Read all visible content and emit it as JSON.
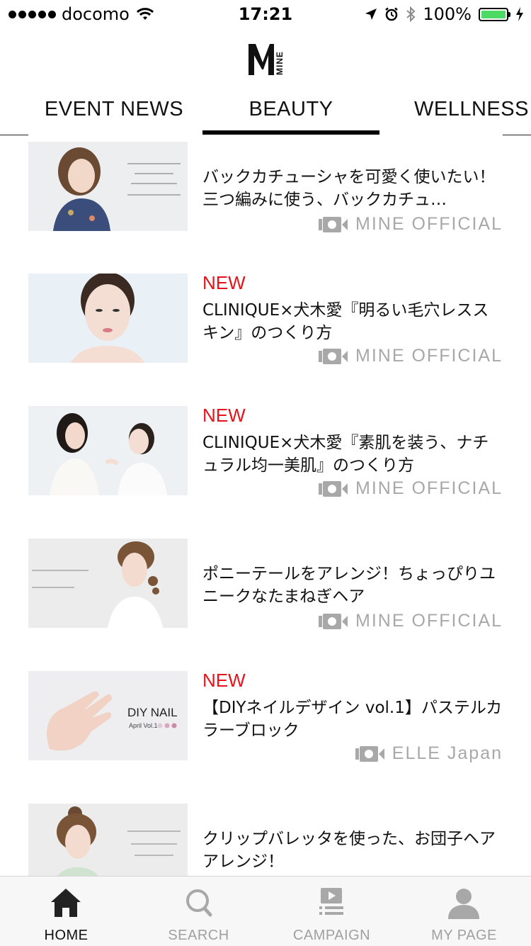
{
  "status_bar": {
    "carrier": "docomo",
    "time": "17:21",
    "battery": "100%",
    "battery_color": "#4cd964"
  },
  "header": {
    "logo_letter": "M",
    "logo_text": "MINE"
  },
  "tabs": [
    {
      "label": "EVENT NEWS",
      "active": false
    },
    {
      "label": "BEAUTY",
      "active": true
    },
    {
      "label": "WELLNESS",
      "active": false
    }
  ],
  "articles": [
    {
      "new": "",
      "title": "バックカチューシャを可愛く使いたい！三つ編みに使う、バックカチュ…",
      "source": "MINE OFFICIAL",
      "source_icon": "video-camera-icon"
    },
    {
      "new": "NEW",
      "title": "CLINIQUE×犬木愛『明るい毛穴レススキン』のつくり方",
      "source": "MINE OFFICIAL",
      "source_icon": "video-camera-icon"
    },
    {
      "new": "NEW",
      "title": "CLINIQUE×犬木愛『素肌を装う、ナチュラル均一美肌』のつくり方",
      "source": "MINE OFFICIAL",
      "source_icon": "video-camera-icon"
    },
    {
      "new": "",
      "title": "ポニーテールをアレンジ！ちょっぴりユニークなたまねぎヘア",
      "source": "MINE OFFICIAL",
      "source_icon": "video-camera-icon"
    },
    {
      "new": "NEW",
      "title": "【DIYネイルデザイン vol.1】パステルカラーブロック",
      "source": "ELLE Japan",
      "source_icon": "video-camera-icon"
    },
    {
      "new": "",
      "title": "クリップバレッタを使った、お団子ヘアアレンジ！",
      "source": "",
      "source_icon": ""
    }
  ],
  "thumbs": {
    "diy_nail_title": "DIY NAIL",
    "diy_nail_sub": "April Vol.1"
  },
  "bottom_nav": [
    {
      "label": "HOME",
      "icon": "home-icon",
      "active": true
    },
    {
      "label": "SEARCH",
      "icon": "search-icon",
      "active": false
    },
    {
      "label": "CAMPAIGN",
      "icon": "campaign-icon",
      "active": false
    },
    {
      "label": "MY PAGE",
      "icon": "user-icon",
      "active": false
    }
  ],
  "colors": {
    "accent_new": "#e8121a",
    "source_gray": "#a8a8a8",
    "nav_inactive": "#a0a0a0"
  }
}
